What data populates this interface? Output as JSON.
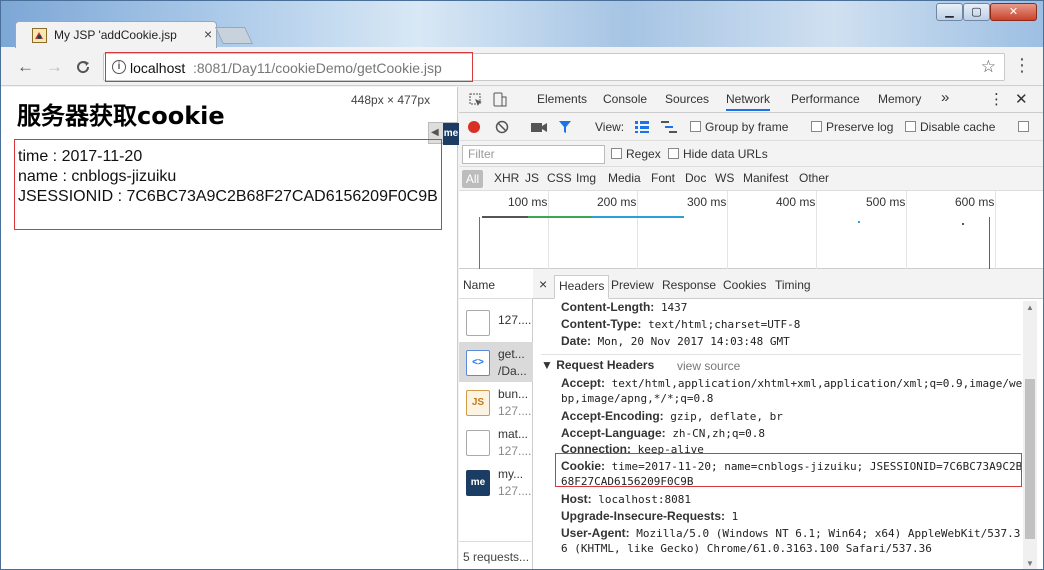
{
  "browser": {
    "tab_title": "My JSP 'addCookie.jsp",
    "tab_close": "×",
    "window_buttons": {
      "min": "▁",
      "max": "▢",
      "close": "✕"
    },
    "nav": {
      "back": "←",
      "forward": "→",
      "reload": "C"
    },
    "url_host": "localhost",
    "url_path": ":8081/Day11/cookieDemo/getCookie.jsp",
    "info_icon": "i",
    "star": "☆",
    "menu": "⋮",
    "accent": "#d9393b"
  },
  "page": {
    "heading": "服务器获取cookie",
    "dimensions": "448px × 477px",
    "cookies": [
      "time : 2017-11-20",
      "name : cnblogs-jizuiku",
      "JSESSIONID : 7C6BC73A9C2B68F27CAD6156209F0C9B"
    ],
    "ext_label": "me"
  },
  "devtools": {
    "tabs": [
      "Elements",
      "Console",
      "Sources",
      "Network",
      "Performance",
      "Memory"
    ],
    "active_tab": "Network",
    "more": "»",
    "menu": "⋮",
    "close": "✕",
    "toolbar": {
      "view_label": "View:",
      "group_by_frame": "Group by frame",
      "preserve_log": "Preserve log",
      "disable_cache": "Disable cache"
    },
    "filter_placeholder": "Filter",
    "regex": "Regex",
    "hide_data_urls": "Hide data URLs",
    "types": [
      "All",
      "XHR",
      "JS",
      "CSS",
      "Img",
      "Media",
      "Font",
      "Doc",
      "WS",
      "Manifest",
      "Other"
    ],
    "timeline_ticks": [
      "100 ms",
      "200 ms",
      "300 ms",
      "400 ms",
      "500 ms",
      "600 ms"
    ],
    "name_header": "Name",
    "requests": [
      {
        "name": "127....",
        "sub": "",
        "icon": ""
      },
      {
        "name": "get...",
        "sub": "/Da...",
        "icon": "<>"
      },
      {
        "name": "bun...",
        "sub": "127....",
        "icon": "JS"
      },
      {
        "name": "mat...",
        "sub": "127....",
        "icon": ""
      },
      {
        "name": "my...",
        "sub": "127....",
        "icon": "me"
      }
    ],
    "footer": "5 requests...",
    "detail_close": "×",
    "detail_tabs": [
      "Headers",
      "Preview",
      "Response",
      "Cookies",
      "Timing"
    ],
    "response_headers": [
      {
        "key": "Content-Length:",
        "value": "1437"
      },
      {
        "key": "Content-Type:",
        "value": "text/html;charset=UTF-8"
      },
      {
        "key": "Date:",
        "value": "Mon, 20 Nov 2017 14:03:48 GMT"
      }
    ],
    "request_headers_title": "▼ Request Headers",
    "view_source": "view source",
    "request_headers": [
      {
        "key": "Accept:",
        "value": "text/html,application/xhtml+xml,application/xml;q=0.9,image/we",
        "cont": "bp,image/apng,*/*;q=0.8"
      },
      {
        "key": "Accept-Encoding:",
        "value": "gzip, deflate, br"
      },
      {
        "key": "Accept-Language:",
        "value": "zh-CN,zh;q=0.8"
      },
      {
        "key": "Connection:",
        "value": "keep-alive"
      },
      {
        "key": "Cookie:",
        "value": "time=2017-11-20; name=cnblogs-jizuiku; JSESSIONID=7C6BC73A9C2B",
        "cont": "68F27CAD6156209F0C9B"
      },
      {
        "key": "Host:",
        "value": "localhost:8081"
      },
      {
        "key": "Upgrade-Insecure-Requests:",
        "value": "1"
      },
      {
        "key": "User-Agent:",
        "value": "Mozilla/5.0 (Windows NT 6.1; Win64; x64) AppleWebKit/537.3",
        "cont": "6 (KHTML, like Gecko) Chrome/61.0.3163.100 Safari/537.36"
      }
    ]
  }
}
